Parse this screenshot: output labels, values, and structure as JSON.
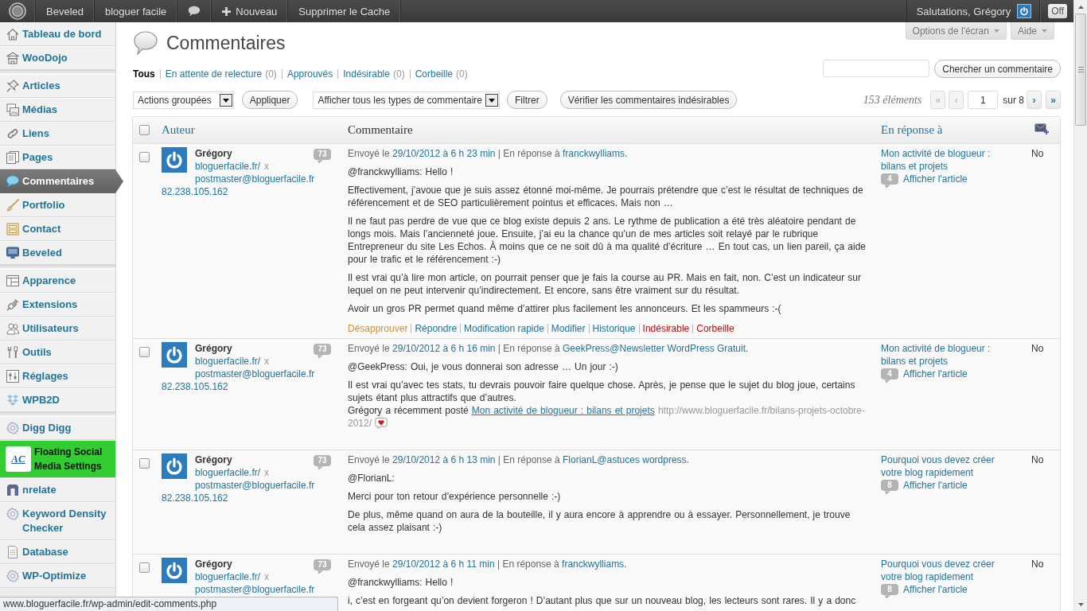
{
  "admin_bar": {
    "items": [
      {
        "kind": "logo"
      },
      {
        "kind": "text",
        "label": "Beveled"
      },
      {
        "kind": "text",
        "label": "bloguer facile"
      },
      {
        "kind": "comments"
      },
      {
        "kind": "new",
        "label": "Nouveau"
      },
      {
        "kind": "text",
        "label": "Supprimer le Cache"
      }
    ],
    "greeting": "Salutations, Grégory",
    "toggle": "Off"
  },
  "sidebar": {
    "groups": [
      [
        {
          "label": "Tableau de bord",
          "selected": false
        },
        {
          "label": "WooDojo",
          "selected": false
        }
      ],
      [
        {
          "label": "Articles",
          "selected": false
        },
        {
          "label": "Médias",
          "selected": false
        },
        {
          "label": "Liens",
          "selected": false
        },
        {
          "label": "Pages",
          "selected": false
        },
        {
          "label": "Commentaires",
          "selected": true
        },
        {
          "label": "Portfolio",
          "selected": false
        },
        {
          "label": "Contact",
          "selected": false
        },
        {
          "label": "Beveled",
          "selected": false
        }
      ],
      [
        {
          "label": "Apparence",
          "selected": false
        },
        {
          "label": "Extensions",
          "selected": false
        },
        {
          "label": "Utilisateurs",
          "selected": false
        },
        {
          "label": "Outils",
          "selected": false
        },
        {
          "label": "Réglages",
          "selected": false
        },
        {
          "label": "WPB2D",
          "selected": false
        }
      ],
      [
        {
          "label": "Digg Digg",
          "selected": false
        },
        {
          "label": "Floating Social Media Settings",
          "logo": "AC",
          "color": "#33cc33",
          "selected": false
        },
        {
          "label": "nrelate",
          "selected": false
        },
        {
          "label": "Keyword Density Checker",
          "selected": false
        },
        {
          "label": "Database",
          "selected": false
        },
        {
          "label": "WP-Optimize",
          "selected": false
        }
      ]
    ]
  },
  "screen_tabs": [
    {
      "label": "Options de l'écran"
    },
    {
      "label": "Aide"
    }
  ],
  "title": "Commentaires",
  "filters": [
    {
      "label": "Tous",
      "selected": true
    },
    {
      "label": "En attente de relecture",
      "count": "(0)",
      "selected": false
    },
    {
      "label": "Approuvés",
      "selected": false
    },
    {
      "label": "Indésirable",
      "count": "(0)",
      "selected": false
    },
    {
      "label": "Corbeille",
      "count": "(0)",
      "selected": false
    }
  ],
  "search": {
    "button": "Chercher un commentaire"
  },
  "tablenav": {
    "bulk_action": "Actions groupées",
    "apply": "Appliquer",
    "comment_type": "Afficher tous les types de commentaire",
    "filter": "Filtrer",
    "check_spam": "Vérifier les commentaires indésirables"
  },
  "pagination": {
    "count": "153 éléments",
    "first": {
      "label": "«",
      "disabled": true
    },
    "previous": {
      "label": "‹",
      "disabled": true
    },
    "current": "1",
    "total": "sur 8",
    "next": {
      "label": "›",
      "disabled": false
    },
    "last": {
      "label": "»",
      "disabled": false
    }
  },
  "table": {
    "select_all": {
      "checked": false
    },
    "columns": [
      {
        "kind": "text",
        "label": "Auteur",
        "sortable": true
      },
      {
        "kind": "text",
        "label": "Commentaire",
        "sortable": false
      },
      {
        "kind": "text",
        "label": "En réponse à",
        "sortable": true
      },
      {
        "kind": "icon"
      }
    ],
    "rows": [
      {
        "checked": false,
        "author": {
          "name": "Grégory",
          "comments": "73",
          "url": "bloguerfacile.fr/",
          "remove": "x",
          "email": "postmaster@bloguerfacile.fr",
          "ip": "82.238.105.162"
        },
        "meta": {
          "sent": "Envoyé le",
          "date": "29/10/2012 à 6 h 23 min",
          "reply_label": "| En réponse à",
          "reply_to": "franckwylliams."
        },
        "body": [
          "@franckwylliams: Hello !",
          "Effectivement, j’avoue que je suis assez étonné moi-même. Je pourrais prétendre que c’est le résultat de techniques de référencement et de SEO particulièrement pointus et efficaces. Mais non …",
          "Il ne faut pas perdre de vue que ce blog existe depuis 2 ans. Le rythme de publication a été très aléatoire pendant de longs mois. Mais l’ancienneté joue. Ensuite, j’ai eu la chance qu’un de mes articles soit relayé par le rubrique Entrepreneur du site Les Echos. À moins que ce ne soit dû à ma qualité d’écriture … En tout cas, un lien pareil, ça aide pour le trafic et le référencement :-)",
          "Il est vrai qu’à lire mon article, on pourrait penser que je fais la course au PR. Mais en fait, non. C’est un indicateur sur lequel on ne peut intervenir qu’indirectement. Et encore, sans être vraiment sur du résultat.",
          "Avoir un gros PR permet quand même d’attirer plus facilement les annonceurs. Et les spammeurs :-("
        ],
        "actions": [
          {
            "label": "Désapprouver",
            "kind": "unapprove"
          },
          {
            "label": "Répondre",
            "kind": "normal"
          },
          {
            "label": "Modification rapide",
            "kind": "normal"
          },
          {
            "label": "Modifier",
            "kind": "normal"
          },
          {
            "label": "Historique",
            "kind": "normal"
          },
          {
            "label": "Indésirable",
            "kind": "spam"
          },
          {
            "label": "Corbeille",
            "kind": "trash"
          }
        ],
        "post": {
          "title": "Mon activité de blogueur : bilans et projets",
          "comments": "4",
          "view": "Afficher l'article"
        },
        "column_5": "No"
      },
      {
        "checked": false,
        "author": {
          "name": "Grégory",
          "comments": "73",
          "url": "bloguerfacile.fr/",
          "remove": "x",
          "email": "postmaster@bloguerfacile.fr",
          "ip": "82.238.105.162"
        },
        "meta": {
          "sent": "Envoyé le",
          "date": "29/10/2012 à 6 h 16 min",
          "reply_label": "| En réponse à",
          "reply_to": "GeekPress@Newsletter WordPress Gratuit."
        },
        "body": [
          "@GeekPress: Oui, je vous donnerai son adresse … Un jour :-)",
          {
            "lines": [
              [
                {
                  "kind": "text",
                  "text": "Il est vrai qu’avec tes stats, tu devrais pouvoir faire quelque chose. Après, je pense que le sujet du blog joue, certains sujets étant plus attractifs que d’autres."
                }
              ],
              [
                {
                  "kind": "text",
                  "text": "Grégory a récemment posté"
                },
                {
                  "kind": "link",
                  "text": "Mon activité de blogueur : bilans et projets"
                },
                {
                  "kind": "muted",
                  "text": "http://www.bloguerfacile.fr/bilans-projets-octobre-2012/"
                },
                {
                  "kind": "emoticon"
                }
              ]
            ]
          }
        ],
        "post": {
          "title": "Mon activité de blogueur : bilans et projets",
          "comments": "4",
          "view": "Afficher l'article"
        },
        "column_5": "No"
      },
      {
        "checked": false,
        "author": {
          "name": "Grégory",
          "comments": "73",
          "url": "bloguerfacile.fr/",
          "remove": "x",
          "email": "postmaster@bloguerfacile.fr",
          "ip": "82.238.105.162"
        },
        "meta": {
          "sent": "Envoyé le",
          "date": "29/10/2012 à 6 h 13 min",
          "reply_label": "| En réponse à",
          "reply_to": "FlorianL@astuces wordpress."
        },
        "body": [
          "@FlorianL:",
          "Merci pour ton retour d’expérience personnelle :-)",
          "De plus, même quand on aura de la bouteille, il y aura encore à apprendre ou à essayer. Personnellement, je trouve cela assez plaisant :-)"
        ],
        "post": {
          "title": "Pourquoi vous devez créer votre blog rapidement",
          "comments": "8",
          "view": "Afficher l'article"
        },
        "column_5": "No"
      },
      {
        "checked": false,
        "author": {
          "name": "Grégory",
          "comments": "73",
          "url": "bloguerfacile.fr/",
          "remove": "x",
          "email": "postmaster@bloguerfacile.fr"
        },
        "meta": {
          "sent": "Envoyé le",
          "date": "29/10/2012 à 6 h 11 min",
          "reply_label": "| En réponse à",
          "reply_to": "franckwylliams."
        },
        "body": [
          "@franckwylliams: Hello !",
          "i, c’est en forgeant qu’on devient forgeron ! D’autant plus que sur un nouveau blog, les lecteurs sont rares. Il y a donc"
        ],
        "post": {
          "title": "Pourquoi vous devez créer votre blog rapidement",
          "comments": "8",
          "view": "Afficher l'article"
        },
        "column_5": "No"
      }
    ]
  },
  "status_bar": "www.bloguerfacile.fr/wp-admin/edit-comments.php"
}
